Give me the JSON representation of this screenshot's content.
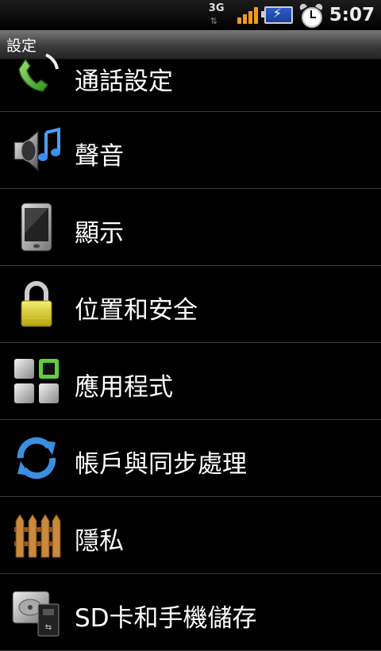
{
  "status_bar": {
    "network": "3G",
    "time": "5:07",
    "signal_level": 4
  },
  "title_bar": {
    "title": "設定"
  },
  "settings": [
    {
      "label": "通話設定",
      "icon": "phone-icon"
    },
    {
      "label": "聲音",
      "icon": "speaker-music-icon"
    },
    {
      "label": "顯示",
      "icon": "phone-screen-icon"
    },
    {
      "label": "位置和安全",
      "icon": "padlock-icon"
    },
    {
      "label": "應用程式",
      "icon": "apps-grid-icon"
    },
    {
      "label": "帳戶與同步處理",
      "icon": "sync-icon"
    },
    {
      "label": "隱私",
      "icon": "fence-icon"
    },
    {
      "label": "SD卡和手機儲存",
      "icon": "storage-icon"
    }
  ]
}
